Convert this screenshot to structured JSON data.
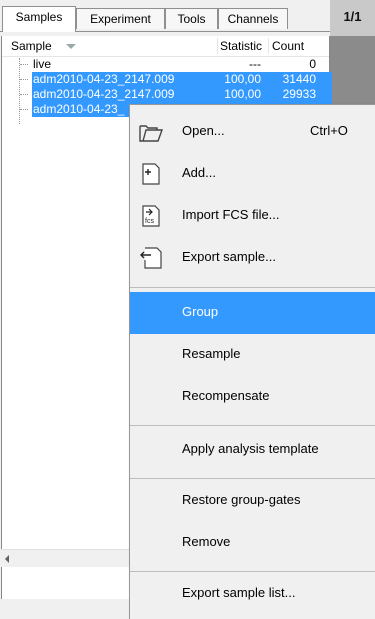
{
  "tabs": [
    {
      "label": "Samples"
    },
    {
      "label": "Experiment"
    },
    {
      "label": "Tools"
    },
    {
      "label": "Channels"
    }
  ],
  "pager": "1/1",
  "columns": {
    "sample": "Sample",
    "statistic": "Statistic",
    "count": "Count"
  },
  "rows": [
    {
      "name": "live",
      "statistic": "---",
      "count": "0",
      "selected": false
    },
    {
      "name": "adm2010-04-23_2147.009",
      "statistic": "100,00",
      "count": "31440",
      "selected": true
    },
    {
      "name": "adm2010-04-23_2147.009",
      "statistic": "100,00",
      "count": "29933",
      "selected": true
    },
    {
      "name": "adm2010-04-23_",
      "statistic": "",
      "count": "",
      "selected": true
    }
  ],
  "menu": {
    "open": {
      "label": "Open...",
      "shortcut": "Ctrl+O"
    },
    "add": {
      "label": "Add..."
    },
    "import": {
      "label": "Import FCS file..."
    },
    "export": {
      "label": "Export sample..."
    },
    "group": {
      "label": "Group"
    },
    "resample": {
      "label": "Resample"
    },
    "recompensate": {
      "label": "Recompensate"
    },
    "apply_template": {
      "label": "Apply analysis template"
    },
    "restore_gates": {
      "label": "Restore group-gates"
    },
    "remove": {
      "label": "Remove"
    },
    "export_list": {
      "label": "Export sample list..."
    }
  },
  "icons": {
    "open": "folder-open-icon",
    "add": "add-file-icon",
    "import": "fcs-import-icon",
    "export": "export-arrow-icon"
  },
  "colors": {
    "selection": "#3399ff",
    "menu_bg": "#f0f0f0"
  }
}
